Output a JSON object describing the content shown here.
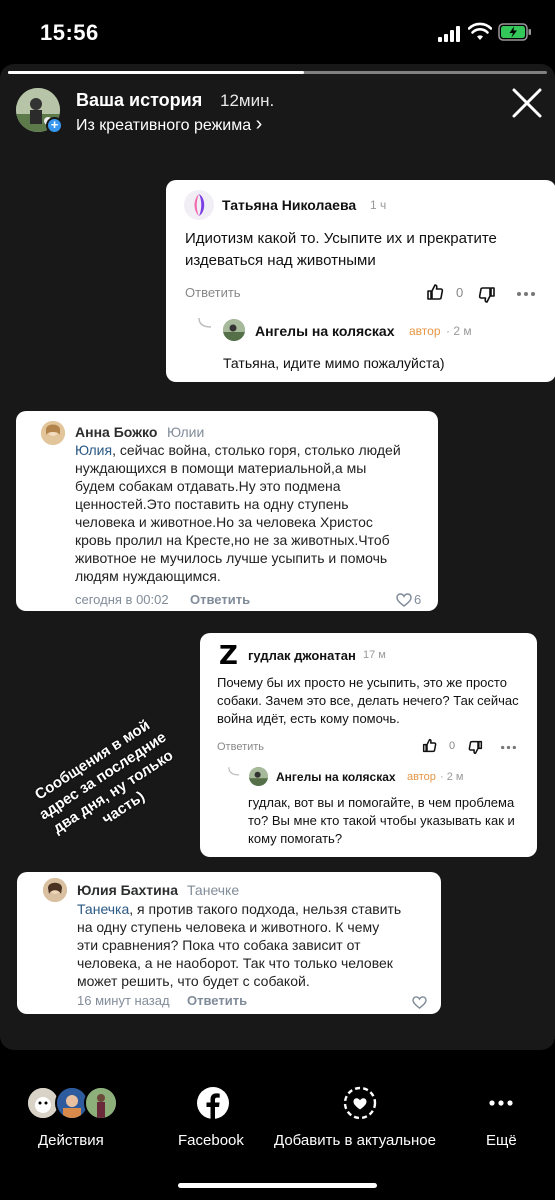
{
  "status_bar": {
    "time": "15:56"
  },
  "story": {
    "progress": 0.55,
    "title": "Ваша история",
    "time_ago": "12мин.",
    "subtitle": "Из креативного режима",
    "subtitle_chevron": "›",
    "plus_badge": "+",
    "close_icon": "close-icon"
  },
  "card1": {
    "author": "Татьяна Николаева",
    "time": "1 ч",
    "text_lines": [
      "Идиотизм какой то. Усыпите их и прекратите",
      "издеваться над животными"
    ],
    "reply_label": "Ответить",
    "likes": "0",
    "reply": {
      "author": "Ангелы на колясках",
      "author_badge": "автор",
      "time": "· 2 м",
      "text": "Татьяна, идите мимо пожалуйста)"
    }
  },
  "card2": {
    "author": "Анна Божко",
    "to": "Юлии",
    "mention": "Юлия",
    "text_lines": [
      ", сейчас война, столько горя, столько людей",
      "нуждающихся в помощи материальной,а мы",
      "будем собакам отдавать.Ну это подмена",
      "ценностей.Это поставить на одну ступень",
      "человека и животное.Но за человека Христос",
      "кровь пролил на Кресте,но не за животных.Чтоб",
      "животное не мучилось лучше усыпить и помочь",
      "людям нуждающимся."
    ],
    "time": "сегодня в 00:02",
    "reply_label": "Ответить",
    "likes": "6"
  },
  "card3": {
    "author": "гудлак джонатан",
    "avatar_letter": "Z",
    "time": "17 м",
    "text_lines": [
      "Почему бы их просто не усыпить, это же просто",
      "собаки. Зачем это все, делать нечего? Так сейчас",
      "война идёт, есть кому помочь."
    ],
    "reply_label": "Ответить",
    "likes": "0",
    "reply": {
      "author": "Ангелы на колясках",
      "author_badge": "автор",
      "time": "· 2 м",
      "text_lines": [
        "гудлак, вот вы и помогайте, в чем проблема",
        "то? Вы мне кто такой чтобы указывать как и",
        "кому помогать?"
      ]
    }
  },
  "card4": {
    "author": "Юлия Бахтина",
    "to": "Танечке",
    "mention": "Танечка",
    "text_lines": [
      ", я против такого подхода, нельзя ставить",
      "на одну ступень человека и животного. К чему",
      "эти сравнения? Пока что собака зависит от",
      "человека, а не наоборот. Так что только человек",
      "может решить, что будет с собакой."
    ],
    "time": "16 минут назад",
    "reply_label": "Ответить"
  },
  "caption_lines": [
    "Сообщения в мой",
    "адрес за последние",
    "два дня, ну только",
    "часть)"
  ],
  "bottom_bar": {
    "actions_label": "Действия",
    "facebook_label": "Facebook",
    "highlight_label": "Добавить в актуальное",
    "more_label": "Ещё"
  },
  "colors": {
    "accent_blue": "#3797f0",
    "author_orange": "#e59543",
    "vk_link": "#2a5885"
  }
}
